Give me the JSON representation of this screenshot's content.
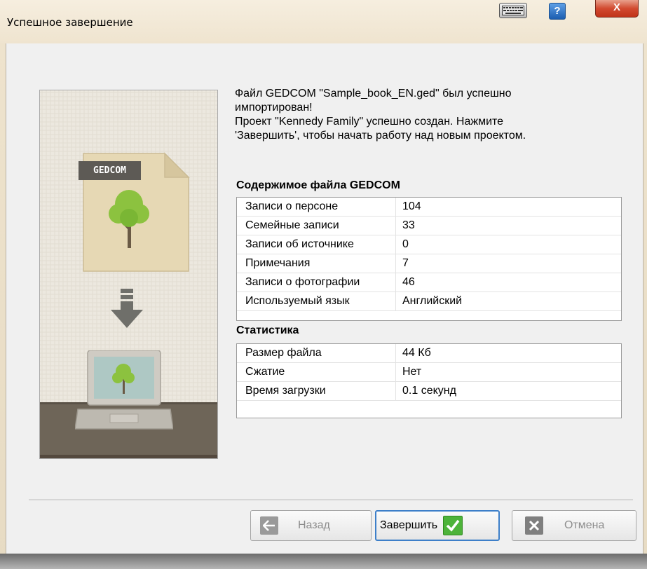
{
  "window": {
    "title": "Успешное завершение",
    "help_label": "?",
    "close_label": "X"
  },
  "illustration": {
    "file_label": "GEDCOM"
  },
  "intro": {
    "line1": "Файл GEDCOM \"Sample_book_EN.ged\" был успешно",
    "line2": "импортирован!",
    "line3": "Проект \"Kennedy Family\" успешно создан. Нажмите",
    "line4": "'Завершить', чтобы начать работу над новым проектом."
  },
  "contents": {
    "title": "Содержимое файла GEDCOM",
    "rows": [
      {
        "label": "Записи о персоне",
        "value": "104"
      },
      {
        "label": "Семейные записи",
        "value": "33"
      },
      {
        "label": "Записи об источнике",
        "value": "0"
      },
      {
        "label": "Примечания",
        "value": "7"
      },
      {
        "label": "Записи о фотографии",
        "value": "46"
      },
      {
        "label": "Используемый язык",
        "value": "Английский"
      }
    ]
  },
  "stats": {
    "title": "Статистика",
    "rows": [
      {
        "label": "Размер файла",
        "value": "44 Кб"
      },
      {
        "label": "Сжатие",
        "value": "Нет"
      },
      {
        "label": "Время загрузки",
        "value": "0.1 секунд"
      }
    ]
  },
  "buttons": {
    "back": "Назад",
    "finish": "Завершить",
    "cancel": "Отмена"
  }
}
